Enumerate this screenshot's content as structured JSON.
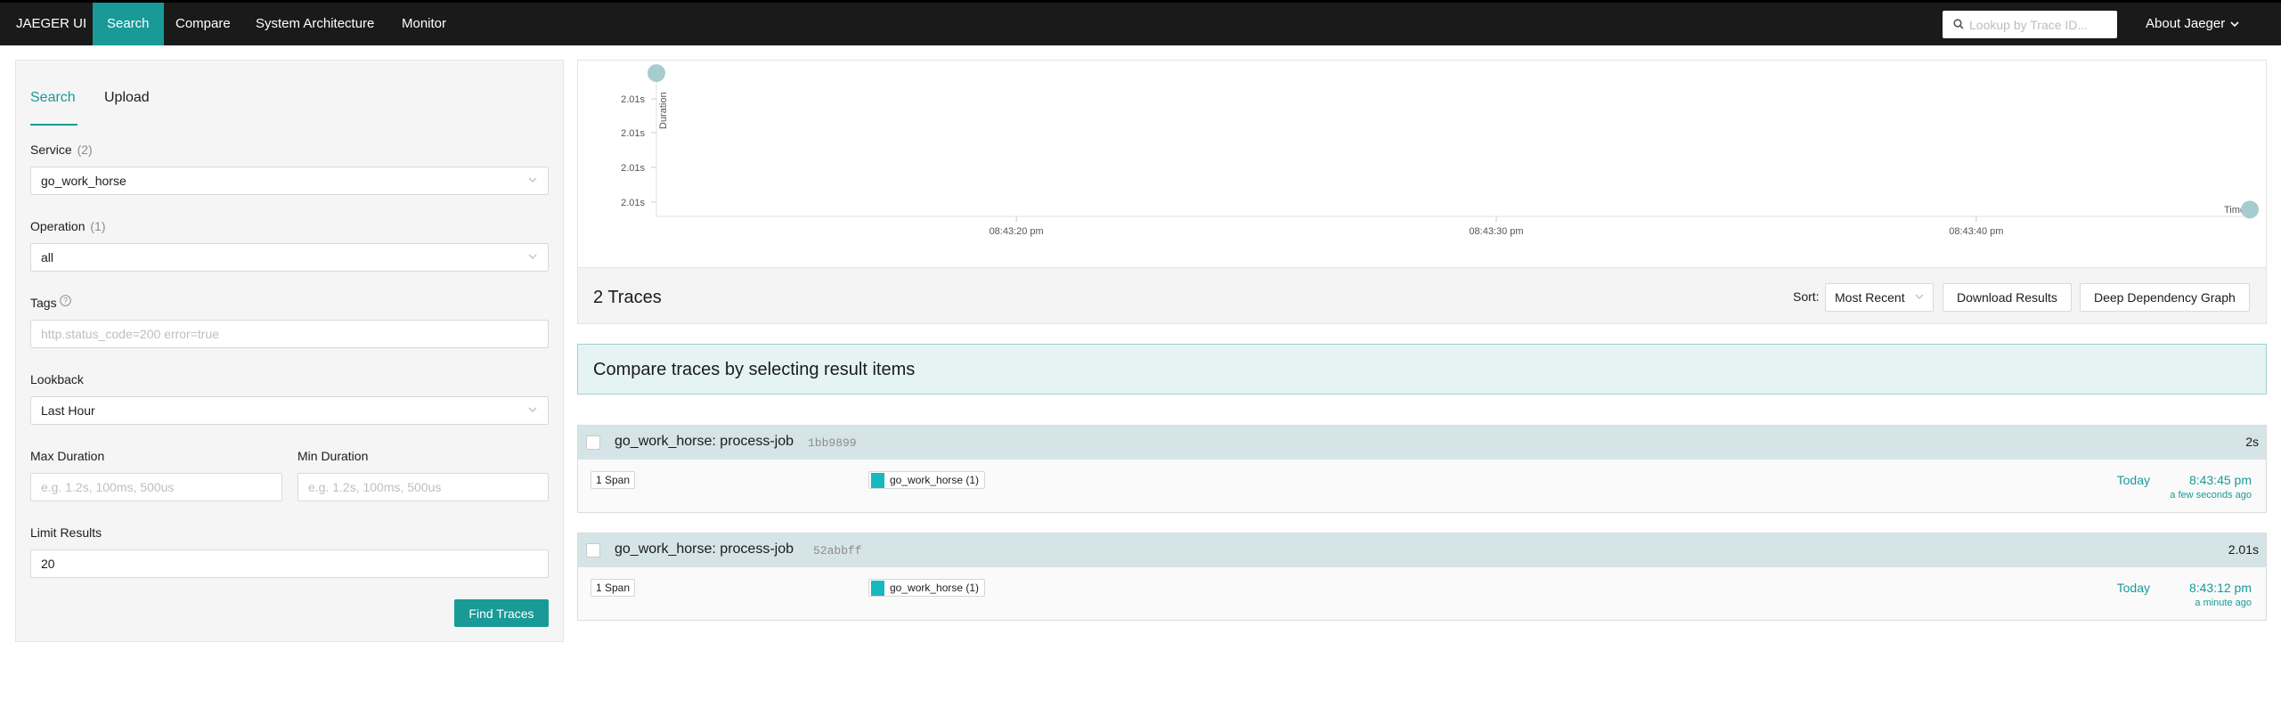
{
  "nav": {
    "brand": "JAEGER UI",
    "items": [
      "Search",
      "Compare",
      "System Architecture",
      "Monitor"
    ],
    "active": "Search",
    "search_placeholder": "Lookup by Trace ID...",
    "about": "About Jaeger",
    "accent": "#199a97"
  },
  "search_form": {
    "tabs": [
      "Search",
      "Upload"
    ],
    "active_tab": "Search",
    "service_label": "Service",
    "service_count": "(2)",
    "service_value": "go_work_horse",
    "operation_label": "Operation",
    "operation_count": "(1)",
    "operation_value": "all",
    "tags_label": "Tags",
    "tags_placeholder": "http.status_code=200 error=true",
    "lookback_label": "Lookback",
    "lookback_value": "Last Hour",
    "max_duration_label": "Max Duration",
    "max_duration_placeholder": "e.g. 1.2s, 100ms, 500us",
    "min_duration_label": "Min Duration",
    "min_duration_placeholder": "e.g. 1.2s, 100ms, 500us",
    "limit_label": "Limit Results",
    "limit_value": "20",
    "find_button": "Find Traces"
  },
  "chart_data": {
    "type": "scatter",
    "ylabel": "Duration",
    "xlabel": "Time",
    "y_tick_labels": [
      "2.01s",
      "2.01s",
      "2.01s",
      "2.01s"
    ],
    "x_tick_labels": [
      "08:43:20 pm",
      "08:43:30 pm",
      "08:43:40 pm"
    ],
    "x_ticks_seconds": [
      20,
      30,
      40
    ],
    "x_range_seconds": [
      12.5,
      45.7
    ],
    "y_range_seconds": [
      1.9995,
      2.0102
    ],
    "series": [
      {
        "points": [
          {
            "x_seconds": 12.5,
            "duration_s": 2.01
          },
          {
            "x_seconds": 45.7,
            "duration_s": 2.0
          }
        ]
      }
    ],
    "point_color": "#a7ccd0"
  },
  "results": {
    "count_text": "2 Traces",
    "sort_label": "Sort:",
    "sort_value": "Most Recent",
    "download_button": "Download Results",
    "dependency_button": "Deep Dependency Graph",
    "compare_banner": "Compare traces by selecting result items"
  },
  "traces": [
    {
      "title": "go_work_horse: process-job",
      "id": "1bb9899",
      "duration": "2s",
      "spans": "1 Span",
      "service": "go_work_horse (1)",
      "date": "Today",
      "time": "8:43:45 pm",
      "ago": "a few seconds ago"
    },
    {
      "title": "go_work_horse: process-job",
      "id": "52abbff",
      "duration": "2.01s",
      "spans": "1 Span",
      "service": "go_work_horse (1)",
      "date": "Today",
      "time": "8:43:12 pm",
      "ago": "a minute ago"
    }
  ]
}
